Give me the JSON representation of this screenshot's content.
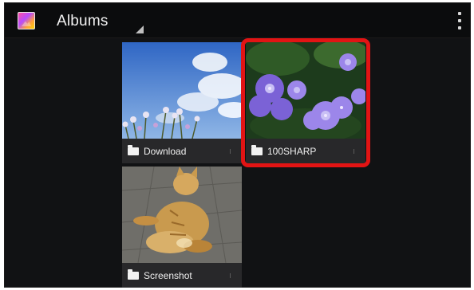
{
  "action_bar": {
    "title": "Albums",
    "app_icon": "gallery-icon",
    "overflow_icon": "overflow-menu-icon"
  },
  "albums": [
    {
      "label": "Download",
      "icon": "folder-icon",
      "thumbnail": "sky-and-flowers"
    },
    {
      "label": "100SHARP",
      "icon": "folder-icon",
      "thumbnail": "purple-hydrangea"
    },
    {
      "label": "Screenshot",
      "icon": "folder-icon",
      "thumbnail": "orange-cat"
    }
  ],
  "colors": {
    "background": "#111214",
    "action_bar": "#0b0c0d",
    "label_bar": "#28282a",
    "highlight": "#e21414"
  }
}
